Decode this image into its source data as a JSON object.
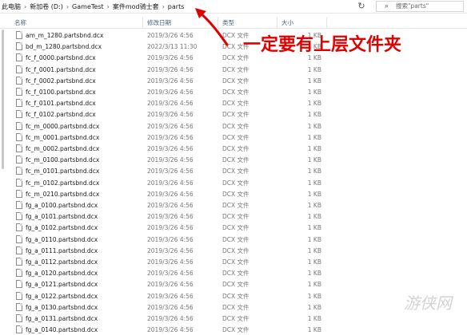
{
  "breadcrumb": [
    "此电脑",
    "新加卷 (D:)",
    "GameTest",
    "案件mod骑士套",
    "parts"
  ],
  "search": {
    "placeholder": "搜索\"parts\""
  },
  "columns": {
    "name": "名称",
    "modified": "修改日期",
    "type": "类型",
    "size": "大小"
  },
  "files": [
    {
      "name": "am_m_1280.partsbnd.dcx",
      "modified": "2019/3/26 4:56",
      "type": "DCX 文件",
      "size": "1 KB"
    },
    {
      "name": "bd_m_1280.partsbnd.dcx",
      "modified": "2022/3/13 11:30",
      "type": "DCX 文件",
      "size": "1 KB"
    },
    {
      "name": "fc_f_0000.partsbnd.dcx",
      "modified": "2019/3/26 4:56",
      "type": "DCX 文件",
      "size": "1 KB"
    },
    {
      "name": "fc_f_0001.partsbnd.dcx",
      "modified": "2019/3/26 4:56",
      "type": "DCX 文件",
      "size": "1 KB"
    },
    {
      "name": "fc_f_0002.partsbnd.dcx",
      "modified": "2019/3/26 4:56",
      "type": "DCX 文件",
      "size": "1 KB"
    },
    {
      "name": "fc_f_0100.partsbnd.dcx",
      "modified": "2019/3/26 4:56",
      "type": "DCX 文件",
      "size": "1 KB"
    },
    {
      "name": "fc_f_0101.partsbnd.dcx",
      "modified": "2019/3/26 4:56",
      "type": "DCX 文件",
      "size": "1 KB"
    },
    {
      "name": "fc_f_0102.partsbnd.dcx",
      "modified": "2019/3/26 4:56",
      "type": "DCX 文件",
      "size": "1 KB"
    },
    {
      "name": "fc_m_0000.partsbnd.dcx",
      "modified": "2019/3/26 4:56",
      "type": "DCX 文件",
      "size": "1 KB"
    },
    {
      "name": "fc_m_0001.partsbnd.dcx",
      "modified": "2019/3/26 4:56",
      "type": "DCX 文件",
      "size": "1 KB"
    },
    {
      "name": "fc_m_0002.partsbnd.dcx",
      "modified": "2019/3/26 4:56",
      "type": "DCX 文件",
      "size": "1 KB"
    },
    {
      "name": "fc_m_0100.partsbnd.dcx",
      "modified": "2019/3/26 4:56",
      "type": "DCX 文件",
      "size": "1 KB"
    },
    {
      "name": "fc_m_0101.partsbnd.dcx",
      "modified": "2019/3/26 4:56",
      "type": "DCX 文件",
      "size": "1 KB"
    },
    {
      "name": "fc_m_0102.partsbnd.dcx",
      "modified": "2019/3/26 4:56",
      "type": "DCX 文件",
      "size": "1 KB"
    },
    {
      "name": "fc_m_0210.partsbnd.dcx",
      "modified": "2019/3/26 4:56",
      "type": "DCX 文件",
      "size": "1 KB"
    },
    {
      "name": "fg_a_0100.partsbnd.dcx",
      "modified": "2019/3/26 4:56",
      "type": "DCX 文件",
      "size": "1 KB"
    },
    {
      "name": "fg_a_0101.partsbnd.dcx",
      "modified": "2019/3/26 4:56",
      "type": "DCX 文件",
      "size": "1 KB"
    },
    {
      "name": "fg_a_0102.partsbnd.dcx",
      "modified": "2019/3/26 4:56",
      "type": "DCX 文件",
      "size": "1 KB"
    },
    {
      "name": "fg_a_0110.partsbnd.dcx",
      "modified": "2019/3/26 4:56",
      "type": "DCX 文件",
      "size": "1 KB"
    },
    {
      "name": "fg_a_0111.partsbnd.dcx",
      "modified": "2019/3/26 4:56",
      "type": "DCX 文件",
      "size": "1 KB"
    },
    {
      "name": "fg_a_0112.partsbnd.dcx",
      "modified": "2019/3/26 4:56",
      "type": "DCX 文件",
      "size": "1 KB"
    },
    {
      "name": "fg_a_0120.partsbnd.dcx",
      "modified": "2019/3/26 4:56",
      "type": "DCX 文件",
      "size": "1 KB"
    },
    {
      "name": "fg_a_0121.partsbnd.dcx",
      "modified": "2019/3/26 4:56",
      "type": "DCX 文件",
      "size": "1 KB"
    },
    {
      "name": "fg_a_0122.partsbnd.dcx",
      "modified": "2019/3/26 4:56",
      "type": "DCX 文件",
      "size": "1 KB"
    },
    {
      "name": "fg_a_0130.partsbnd.dcx",
      "modified": "2019/3/26 4:56",
      "type": "DCX 文件",
      "size": "1 KB"
    },
    {
      "name": "fg_a_0131.partsbnd.dcx",
      "modified": "2019/3/26 4:56",
      "type": "DCX 文件",
      "size": "1 KB"
    },
    {
      "name": "fg_a_0140.partsbnd.dcx",
      "modified": "2019/3/26 4:56",
      "type": "DCX 文件",
      "size": "1 KB"
    }
  ],
  "annotation": {
    "text": "一定要有上层文件夹",
    "color": "#e10000"
  },
  "watermark": {
    "text": "游侠网"
  },
  "colors": {
    "header_text": "#4c607a",
    "annotation": "#e10000"
  }
}
